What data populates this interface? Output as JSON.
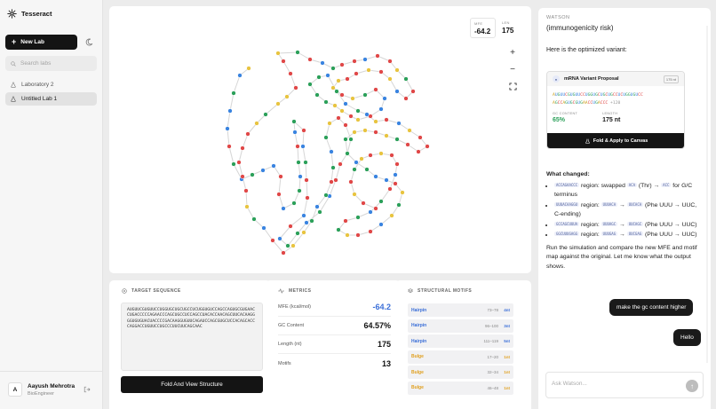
{
  "app": {
    "name": "Tesseract"
  },
  "sidebar": {
    "new_lab_label": "New Lab",
    "search_placeholder": "Search labs",
    "items": [
      {
        "label": "Laboratory 2"
      },
      {
        "label": "Untitled Lab 1"
      }
    ],
    "user": {
      "initial": "A",
      "name": "Aayush Mehrotra",
      "role": "BioEngineer"
    }
  },
  "canvas": {
    "mfe_label": "MFE",
    "mfe_value": "-64.2",
    "len_label": "LEN",
    "len_value": "175",
    "zoom_in": "+",
    "zoom_out": "−",
    "fit_icon": "fit-screen-icon",
    "nucleotide_colors": {
      "A": "#e8c440",
      "U": "#3a84e0",
      "G": "#2ca05a",
      "C": "#e04848"
    }
  },
  "target_sequence": {
    "title": "TARGET SEQUENCE",
    "sequence": "AUGUUCGUGUUCCUGGUGCUGCUGCCUCUGGUGUCCAGCCAGUGCGUGAACCUGACCCCCAGAACCCAGCUGCCUCCAGCCUACACCAACAGCUUCACAAGGGGUGUGUACUACCCCGACAAGGUGUUCAGAUCCAGCGUGCUCCACAGCACCCAGGACCUGUUCCUGCCCUUCUUCAGCAAC",
    "button_label": "Fold And View Structure"
  },
  "metrics": {
    "title": "METRICS",
    "items": [
      {
        "label": "MFE (kcal/mol)",
        "value": "-64.2"
      },
      {
        "label": "GC Content",
        "value": "64.57%"
      },
      {
        "label": "Length (nt)",
        "value": "175"
      },
      {
        "label": "Motifs",
        "value": "13"
      }
    ]
  },
  "motifs": {
    "title": "STRUCTURAL MOTIFS",
    "items": [
      {
        "name": "Hairpin",
        "range": "73–78",
        "len": "4nt",
        "color": "#3b6fd8"
      },
      {
        "name": "Hairpin",
        "range": "96–100",
        "len": "3nt",
        "color": "#3b6fd8"
      },
      {
        "name": "Hairpin",
        "range": "111–119",
        "len": "5nt",
        "color": "#3b6fd8"
      },
      {
        "name": "Bulge",
        "range": "17–20",
        "len": "1nt",
        "color": "#e0a020"
      },
      {
        "name": "Bulge",
        "range": "32–34",
        "len": "1nt",
        "color": "#e0a020"
      },
      {
        "name": "Bulge",
        "range": "46–48",
        "len": "1nt",
        "color": "#e0a020"
      }
    ]
  },
  "chat": {
    "header": "WATSON",
    "intro_line1": "(immunogenicity risk)",
    "intro_line2": "Here is the optimized variant:",
    "variant": {
      "title": "mRNA Variant Proposal",
      "badge": "175 nt",
      "seq_line1": "AUGUUCGUGUUCCUGGUGCUGCUGCCUCUGGUGUCC",
      "seq_line2": "AGCCAGUGCGUGAACCUGACCC",
      "seq_more": "+120",
      "gc_label": "GC CONTENT",
      "gc_value": "65%",
      "length_label": "LENGTH",
      "length_value": "175 nt",
      "apply_label": "Fold & Apply to Canvas"
    },
    "changes_title": "What changed:",
    "changes": [
      {
        "chip1": "ACCAGAACCC",
        "text1": " region: swapped ",
        "chip2": "ACA",
        "text2": " (Thr) → ",
        "chip3": "ACC",
        "text3": " for G/C terminus"
      },
      {
        "chip1": "UUUACAAGGU",
        "text1": " region: ",
        "chip2": "UUUACA",
        "text2": " → ",
        "chip3": "UUCACA",
        "text3": " (Phe UUU → UUC, C-ending)"
      },
      {
        "chip1": "GCCAGCUUUA",
        "text1": " region: ",
        "chip2": "UUUAGC",
        "text2": " → ",
        "chip3": "UUCAGC",
        "text3": " (Phe UUU → UUC)"
      },
      {
        "chip1": "GGCUUUGAGG",
        "text1": " region: ",
        "chip2": "UUUGAG",
        "text2": " → ",
        "chip3": "UUCGAG",
        "text3": " (Phe UUU → UUC)"
      }
    ],
    "closing": "Run the simulation and compare the new MFE and motif map against the original. Let me know what the output shows.",
    "user_messages": [
      "make the gc content higher",
      "Hello"
    ],
    "input_placeholder": "Ask Watson..."
  }
}
